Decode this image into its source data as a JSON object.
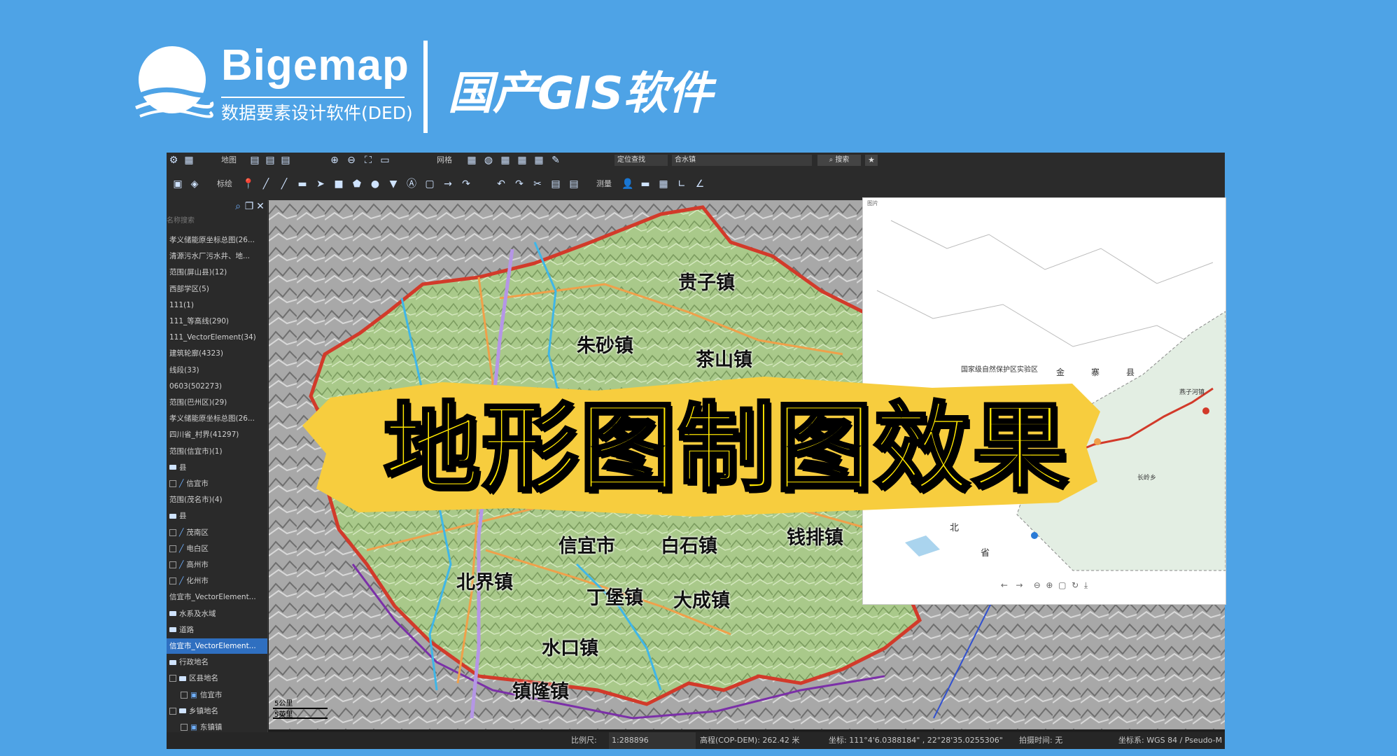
{
  "brand": {
    "name": "Bigemap",
    "subtitle": "数据要素设计软件(DED)",
    "tagline": "国产GIS软件"
  },
  "toolbar_top": {
    "map_label": "地图",
    "grid_label": "网格",
    "locate_mode": "定位查找",
    "search_value": "合水镇",
    "search_button": "搜索"
  },
  "toolbar_draw": {
    "draw_label": "标绘",
    "measure_label": "测量"
  },
  "sidebar": {
    "search_placeholder": "名称搜索",
    "layers": [
      {
        "label": "孝义储能原坐标总图(26...",
        "kind": "text"
      },
      {
        "label": "清源污水厂污水井、地...",
        "kind": "text"
      },
      {
        "label": "范围(屏山县)(12)",
        "kind": "text"
      },
      {
        "label": "西部学区(5)",
        "kind": "text"
      },
      {
        "label": "111(1)",
        "kind": "text"
      },
      {
        "label": "111_等高线(290)",
        "kind": "text"
      },
      {
        "label": "111_VectorElement(34)",
        "kind": "text"
      },
      {
        "label": "建筑轮廓(4323)",
        "kind": "text"
      },
      {
        "label": "线段(33)",
        "kind": "text"
      },
      {
        "label": "0603(502273)",
        "kind": "text"
      },
      {
        "label": "范围(巴州区)(29)",
        "kind": "text"
      },
      {
        "label": "孝义储能原坐标总图(26...",
        "kind": "text"
      },
      {
        "label": "四川省_村界(41297)",
        "kind": "text"
      },
      {
        "label": "范围(信宜市)(1)",
        "kind": "text"
      },
      {
        "label": "县",
        "kind": "folder"
      },
      {
        "label": "信宜市",
        "kind": "line"
      },
      {
        "label": "范围(茂名市)(4)",
        "kind": "text"
      },
      {
        "label": "县",
        "kind": "folder"
      },
      {
        "label": "茂南区",
        "kind": "line"
      },
      {
        "label": "电白区",
        "kind": "line"
      },
      {
        "label": "高州市",
        "kind": "line"
      },
      {
        "label": "化州市",
        "kind": "line"
      },
      {
        "label": "信宜市_VectorElement...",
        "kind": "text"
      },
      {
        "label": "水系及水域",
        "kind": "folder"
      },
      {
        "label": "道路",
        "kind": "folder"
      },
      {
        "label": "信宜市_VectorElement...",
        "kind": "selected"
      },
      {
        "label": "行政地名",
        "kind": "folder"
      },
      {
        "label": "区县地名",
        "kind": "folder-chk"
      },
      {
        "label": "信宜市",
        "kind": "sub"
      },
      {
        "label": "乡镇地名",
        "kind": "folder-chk"
      },
      {
        "label": "东镇镇",
        "kind": "sub"
      }
    ]
  },
  "map": {
    "towns": [
      "贵子镇",
      "朱砂镇",
      "茶山镇",
      "钱排镇",
      "信宜市",
      "白石镇",
      "北界镇",
      "丁堡镇",
      "大成镇",
      "水口镇",
      "镇隆镇"
    ],
    "scale_labels": [
      "5公里",
      "5英里"
    ]
  },
  "inset": {
    "title": "图片",
    "labels": [
      "国家级自然保护区实验区",
      "金",
      "寨",
      "县",
      "北",
      "省",
      "长岭乡",
      "燕子河镇"
    ]
  },
  "banner": {
    "text": "地形图制图效果"
  },
  "statusbar": {
    "scale_label": "比例尺:",
    "scale_value": "1:288896",
    "elevation": "高程(COP-DEM): 262.42 米",
    "coords": "坐标: 111°4'6.0388184\" , 22°28'35.0255306\"",
    "shot_time": "拍摄时间: 无",
    "crs": "坐标系: WGS 84 / Pseudo-M"
  },
  "colors": {
    "background": "#4ea3e6",
    "banner_brush": "#f7cd3e",
    "banner_text": "#ffe600",
    "terrain_green": "#a9c98a",
    "border_red": "#d23a2a",
    "border_purple": "#7b2fa8",
    "road_orange": "#f0a04a",
    "river_blue": "#3fb6e8"
  },
  "icons": [
    "logo-icon",
    "map-icon",
    "zoom-in-icon",
    "zoom-out-icon",
    "grid-icon",
    "search-icon",
    "star-icon",
    "pin-icon",
    "line-icon",
    "rect-icon",
    "polygon-icon",
    "circle-icon",
    "undo-icon",
    "redo-icon",
    "cut-icon",
    "measure-icon",
    "close-icon",
    "folder-icon",
    "checkbox-icon"
  ]
}
